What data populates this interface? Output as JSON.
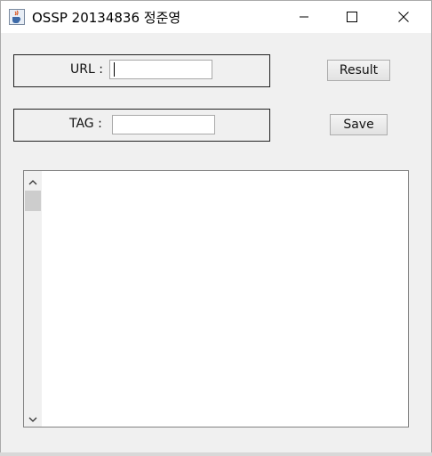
{
  "window": {
    "title": "OSSP 20134836 정준영",
    "app_icon": "java-cup-icon",
    "controls": {
      "minimize_icon": "minimize-icon",
      "maximize_icon": "maximize-icon",
      "close_icon": "close-icon"
    }
  },
  "form": {
    "url": {
      "label": "URL :",
      "value": ""
    },
    "tag": {
      "label": "TAG :",
      "value": ""
    },
    "result_label": "Result",
    "save_label": "Save"
  },
  "output": {
    "text": "",
    "scrollbar": {
      "up_icon": "chevron-up-icon",
      "down_icon": "chevron-down-icon"
    }
  },
  "colors": {
    "window_bg": "#f0f0f0",
    "titlebar_bg": "#ffffff",
    "panel_border": "#222222"
  }
}
